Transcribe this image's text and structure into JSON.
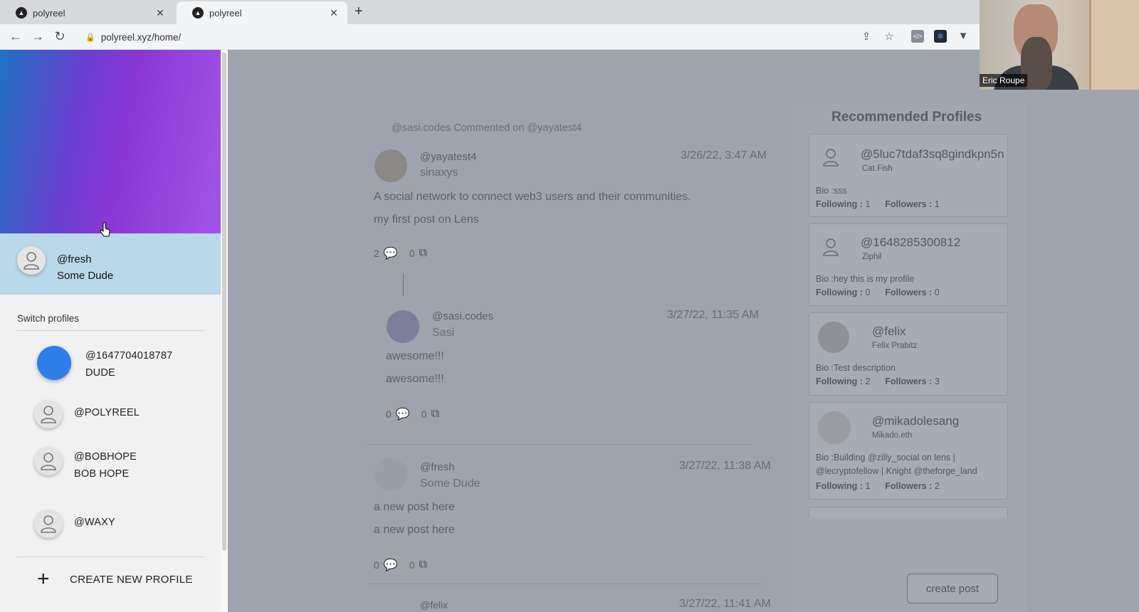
{
  "browser": {
    "tabs": [
      {
        "title": "polyreel",
        "active": false
      },
      {
        "title": "polyreel",
        "active": true
      }
    ],
    "url": "polyreel.xyz/home/"
  },
  "video": {
    "name": "Eric Roupe"
  },
  "drawer": {
    "current_profile": {
      "handle": "@fresh",
      "name": "Some Dude"
    },
    "switch_title": "Switch profiles",
    "profiles": [
      {
        "handle": "@1647704018787",
        "name": "DUDE"
      },
      {
        "handle": "@POLYREEL",
        "name": ""
      },
      {
        "handle": "@BOBHOPE",
        "name": "BOB HOPE"
      },
      {
        "handle": "@WAXY",
        "name": ""
      }
    ],
    "create_label": "CREATE NEW PROFILE"
  },
  "feed": {
    "activity": "@sasi.codes Commented on @yayatest4",
    "post1": {
      "handle": "@yayatest4",
      "name": "sinaxys",
      "time": "3/26/22, 3:47 AM",
      "line1": "A social network to connect web3 users and their communities.",
      "line2": "my first post on Lens",
      "comments": "2",
      "mirrors": "0"
    },
    "comment": {
      "handle": "@sasi.codes",
      "name": "Sasi",
      "time": "3/27/22, 11:35 AM",
      "line1": "awesome!!!",
      "line2": "awesome!!!",
      "comments": "0",
      "mirrors": "0"
    },
    "post2": {
      "handle": "@fresh",
      "name": "Some Dude",
      "time": "3/27/22, 11:38 AM",
      "line1": "a new post here",
      "line2": "a new post here",
      "comments": "0",
      "mirrors": "0"
    },
    "post3": {
      "handle": "@felix",
      "time": "3/27/22, 11:41 AM"
    }
  },
  "recommended": {
    "title": "Recommended Profiles",
    "cards": [
      {
        "handle": "@5luc7tdaf3sq8gindkpn5n",
        "name": "Cat.Fish",
        "bio": "sss",
        "following": "1",
        "followers": "1"
      },
      {
        "handle": "@1648285300812",
        "name": "Ziphil",
        "bio": "hey this is my profile",
        "following": "0",
        "followers": "0"
      },
      {
        "handle": "@felix",
        "name": "Felix Prabitz",
        "bio": "Test description",
        "following": "2",
        "followers": "3"
      },
      {
        "handle": "@mikadolesang",
        "name": "Mikado.eth",
        "bio": "Building @zilly_social on lens | @lecryptofellow | Knight @theforge_land",
        "following": "1",
        "followers": "2"
      }
    ],
    "labels": {
      "bio": "Bio :",
      "following": "Following : ",
      "followers": "Followers : "
    }
  },
  "create_post": "create post"
}
